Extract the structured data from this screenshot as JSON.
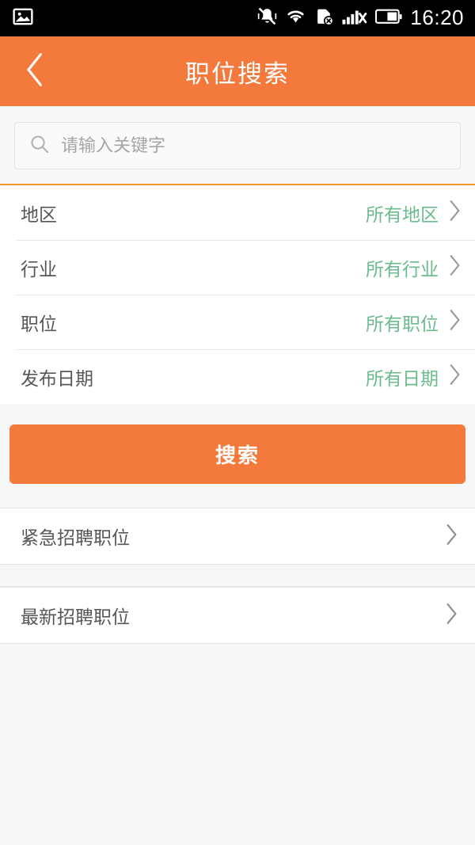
{
  "status_bar": {
    "time": "16:20",
    "icons": [
      {
        "name": "photo-icon",
        "position": "left"
      },
      {
        "name": "vibrate-mute-icon",
        "position": "right"
      },
      {
        "name": "wifi-icon",
        "position": "right"
      },
      {
        "name": "sim-card-off-icon",
        "position": "right"
      },
      {
        "name": "signal-off-icon",
        "position": "right"
      },
      {
        "name": "battery-icon",
        "position": "right"
      }
    ]
  },
  "header": {
    "title": "职位搜索",
    "back_icon": "chevron-left-icon",
    "background_color": "#f37a3c"
  },
  "search": {
    "icon": "search-icon",
    "placeholder": "请输入关键字",
    "value": ""
  },
  "filters": [
    {
      "label": "地区",
      "value": "所有地区",
      "icon": "chevron-right-icon"
    },
    {
      "label": "行业",
      "value": "所有行业",
      "icon": "chevron-right-icon"
    },
    {
      "label": "职位",
      "value": "所有职位",
      "icon": "chevron-right-icon"
    },
    {
      "label": "发布日期",
      "value": "所有日期",
      "icon": "chevron-right-icon"
    }
  ],
  "search_button": {
    "label": "搜索",
    "color": "#f37a3c"
  },
  "links": [
    {
      "label": "紧急招聘职位",
      "icon": "chevron-right-icon"
    },
    {
      "label": "最新招聘职位",
      "icon": "chevron-right-icon"
    }
  ],
  "colors": {
    "accent_orange": "#f37a3c",
    "divider_orange": "#f7941d",
    "value_green": "#6bbb8d",
    "label_gray": "#575757",
    "page_background": "#f5f6f6"
  }
}
